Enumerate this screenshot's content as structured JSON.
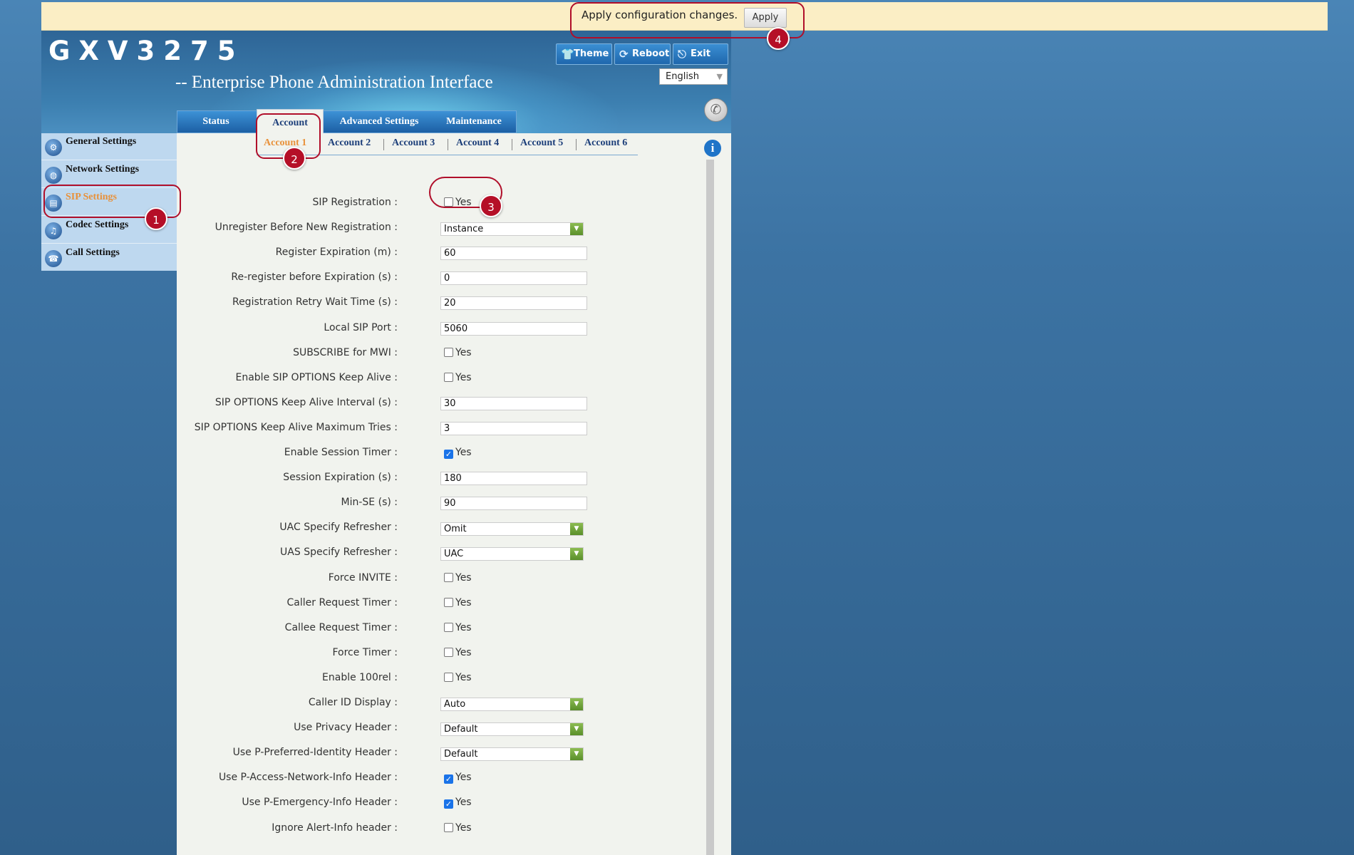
{
  "apply_bar": {
    "message": "Apply configuration changes.",
    "apply_label": "Apply"
  },
  "header": {
    "logo": "GXV3275",
    "subtitle": "-- Enterprise Phone Administration Interface",
    "buttons": {
      "theme": "Theme",
      "reboot": "Reboot",
      "exit": "Exit"
    },
    "language": "English"
  },
  "main_tabs": [
    "Status",
    "Account",
    "Advanced Settings",
    "Maintenance"
  ],
  "sub_tabs": [
    "Account 1",
    "Account 2",
    "Account 3",
    "Account 4",
    "Account 5",
    "Account 6"
  ],
  "sidebar": [
    "General Settings",
    "Network Settings",
    "SIP Settings",
    "Codec Settings",
    "Call Settings"
  ],
  "annotations": [
    "1",
    "2",
    "3",
    "4"
  ],
  "form": {
    "yes_label": "Yes",
    "fields": [
      {
        "label": "SIP Registration :",
        "type": "check",
        "checked": false
      },
      {
        "label": "Unregister Before New Registration :",
        "type": "select",
        "value": "Instance"
      },
      {
        "label": "Register Expiration (m) :",
        "type": "text",
        "value": "60"
      },
      {
        "label": "Re-register before Expiration (s) :",
        "type": "text",
        "value": "0"
      },
      {
        "label": "Registration Retry Wait Time (s) :",
        "type": "text",
        "value": "20"
      },
      {
        "label": "Local SIP Port :",
        "type": "text",
        "value": "5060"
      },
      {
        "label": "SUBSCRIBE for MWI :",
        "type": "check",
        "checked": false
      },
      {
        "label": "Enable SIP OPTIONS Keep Alive :",
        "type": "check",
        "checked": false
      },
      {
        "label": "SIP OPTIONS Keep Alive Interval (s) :",
        "type": "text",
        "value": "30"
      },
      {
        "label": "SIP OPTIONS Keep Alive Maximum Tries :",
        "type": "text",
        "value": "3"
      },
      {
        "label": "Enable Session Timer :",
        "type": "check",
        "checked": true
      },
      {
        "label": "Session Expiration (s) :",
        "type": "text",
        "value": "180"
      },
      {
        "label": "Min-SE (s) :",
        "type": "text",
        "value": "90"
      },
      {
        "label": "UAC Specify Refresher :",
        "type": "select",
        "value": "Omit"
      },
      {
        "label": "UAS Specify Refresher :",
        "type": "select",
        "value": "UAC"
      },
      {
        "label": "Force INVITE :",
        "type": "check",
        "checked": false
      },
      {
        "label": "Caller Request Timer :",
        "type": "check",
        "checked": false
      },
      {
        "label": "Callee Request Timer :",
        "type": "check",
        "checked": false
      },
      {
        "label": "Force Timer :",
        "type": "check",
        "checked": false
      },
      {
        "label": "Enable 100rel :",
        "type": "check",
        "checked": false
      },
      {
        "label": "Caller ID Display :",
        "type": "select",
        "value": "Auto"
      },
      {
        "label": "Use Privacy Header :",
        "type": "select",
        "value": "Default"
      },
      {
        "label": "Use P-Preferred-Identity Header :",
        "type": "select",
        "value": "Default"
      },
      {
        "label": "Use P-Access-Network-Info Header :",
        "type": "check",
        "checked": true
      },
      {
        "label": "Use P-Emergency-Info Header :",
        "type": "check",
        "checked": true
      },
      {
        "label": "Ignore Alert-Info header :",
        "type": "check",
        "checked": false
      }
    ]
  }
}
